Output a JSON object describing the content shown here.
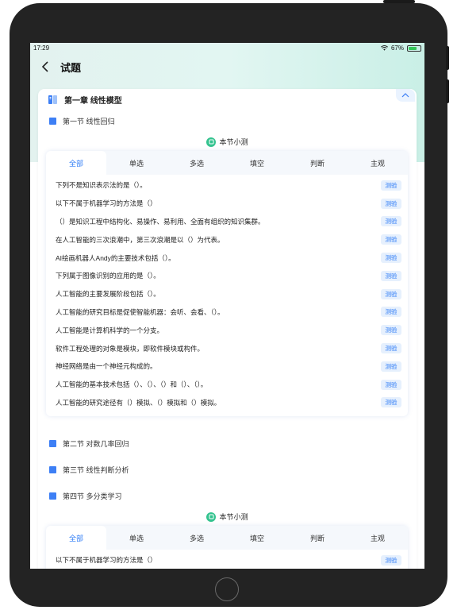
{
  "status_bar": {
    "time": "17:29",
    "battery": "67%"
  },
  "header": {
    "title": "试题"
  },
  "chapter": {
    "title": "第一章 线性模型"
  },
  "sections": [
    {
      "label": "第一节 线性回归"
    },
    {
      "label": "第二节 对数几率回归"
    },
    {
      "label": "第三节 线性判断分析"
    },
    {
      "label": "第四节 多分类学习"
    }
  ],
  "quiz": {
    "label": "本节小测"
  },
  "tabs": [
    "全部",
    "单选",
    "多选",
    "填空",
    "判断",
    "主观"
  ],
  "test_label": "测验",
  "questions": [
    "下列不是知识表示法的是（）。",
    "以下不属于机器学习的方法是（）",
    "（）是知识工程中结构化、易操作、易利用、全面有组织的知识集群。",
    "在人工智能的三次浪潮中，第三次浪潮是以（）为代表。",
    "AI绘画机器人Andy的主要技术包括（）。",
    "下列属于图像识别的应用的是（）。",
    "人工智能的主要发展阶段包括（）。",
    "人工智能的研究目标是促使智能机器：会听、会看、（）。",
    "人工智能是计算机科学的一个分支。",
    "软件工程处理的对象是模块，即软件模块或构件。",
    "神经网络是由一个神经元构成的。",
    "人工智能的基本技术包括（）、（）、（）和（）、（）。",
    "人工智能的研究途径有（）模拟、（）模拟和（）模拟。"
  ],
  "questions_section4": [
    "以下不属于机器学习的方法是（）"
  ]
}
